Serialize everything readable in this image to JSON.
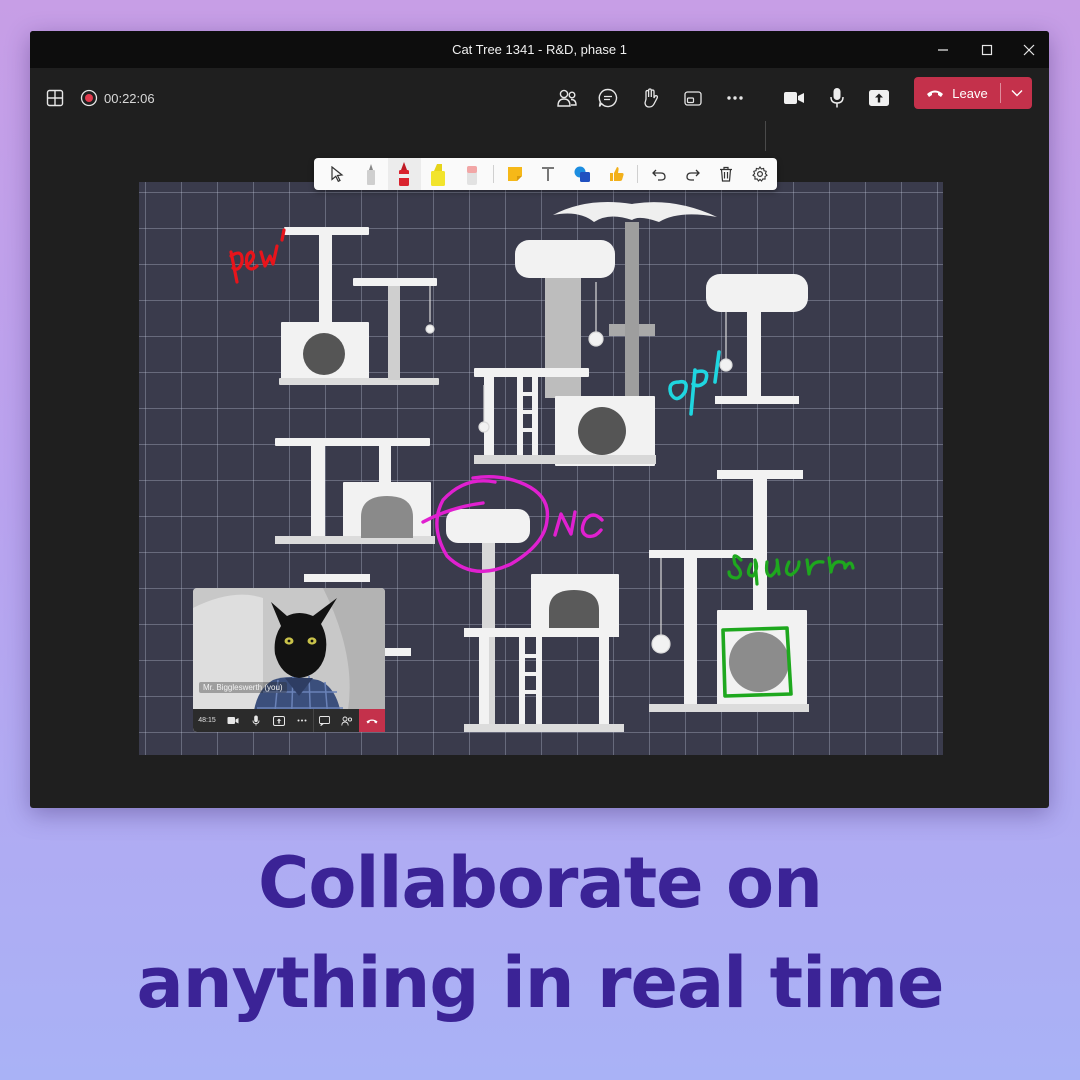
{
  "window": {
    "title": "Cat Tree 1341 - R&D, phase 1",
    "controls": [
      "minimize-icon",
      "maximize-icon",
      "close-icon"
    ]
  },
  "toolbar": {
    "timer": "00:22:06",
    "leave_label": "Leave",
    "left_icons": [
      "grid-view-icon",
      "recording-icon"
    ],
    "right_icons": [
      "people-icon",
      "chat-icon",
      "raise-hand-icon",
      "view-icon",
      "more-icon",
      "camera-icon",
      "mic-icon",
      "share-icon"
    ],
    "leave_color": "#c4314b"
  },
  "ink_toolbar": {
    "tools": [
      "select-icon",
      "pen-icon",
      "red-marker-icon",
      "highlighter-icon",
      "eraser-icon",
      "sticky-note-icon",
      "text-icon",
      "shapes-icon",
      "reaction-icon",
      "undo-icon",
      "redo-icon",
      "delete-icon",
      "settings-icon"
    ]
  },
  "whiteboard": {
    "annotations": [
      {
        "text": "pew",
        "color": "#e8141b"
      },
      {
        "text": "op!",
        "color": "#1fd6e0"
      },
      {
        "text": "nc",
        "color": "#e020d0"
      },
      {
        "text": "squar",
        "color": "#1ea81e"
      }
    ]
  },
  "self_view": {
    "name": "Mr. Biggleswerth (you)",
    "timer": "48:15",
    "controls": [
      "camera-icon",
      "mic-icon",
      "share-icon",
      "more-icon",
      "chat-icon",
      "people-icon",
      "hangup-icon"
    ]
  },
  "headline": {
    "line1": "Collaborate on",
    "line2": "anything in real time"
  }
}
